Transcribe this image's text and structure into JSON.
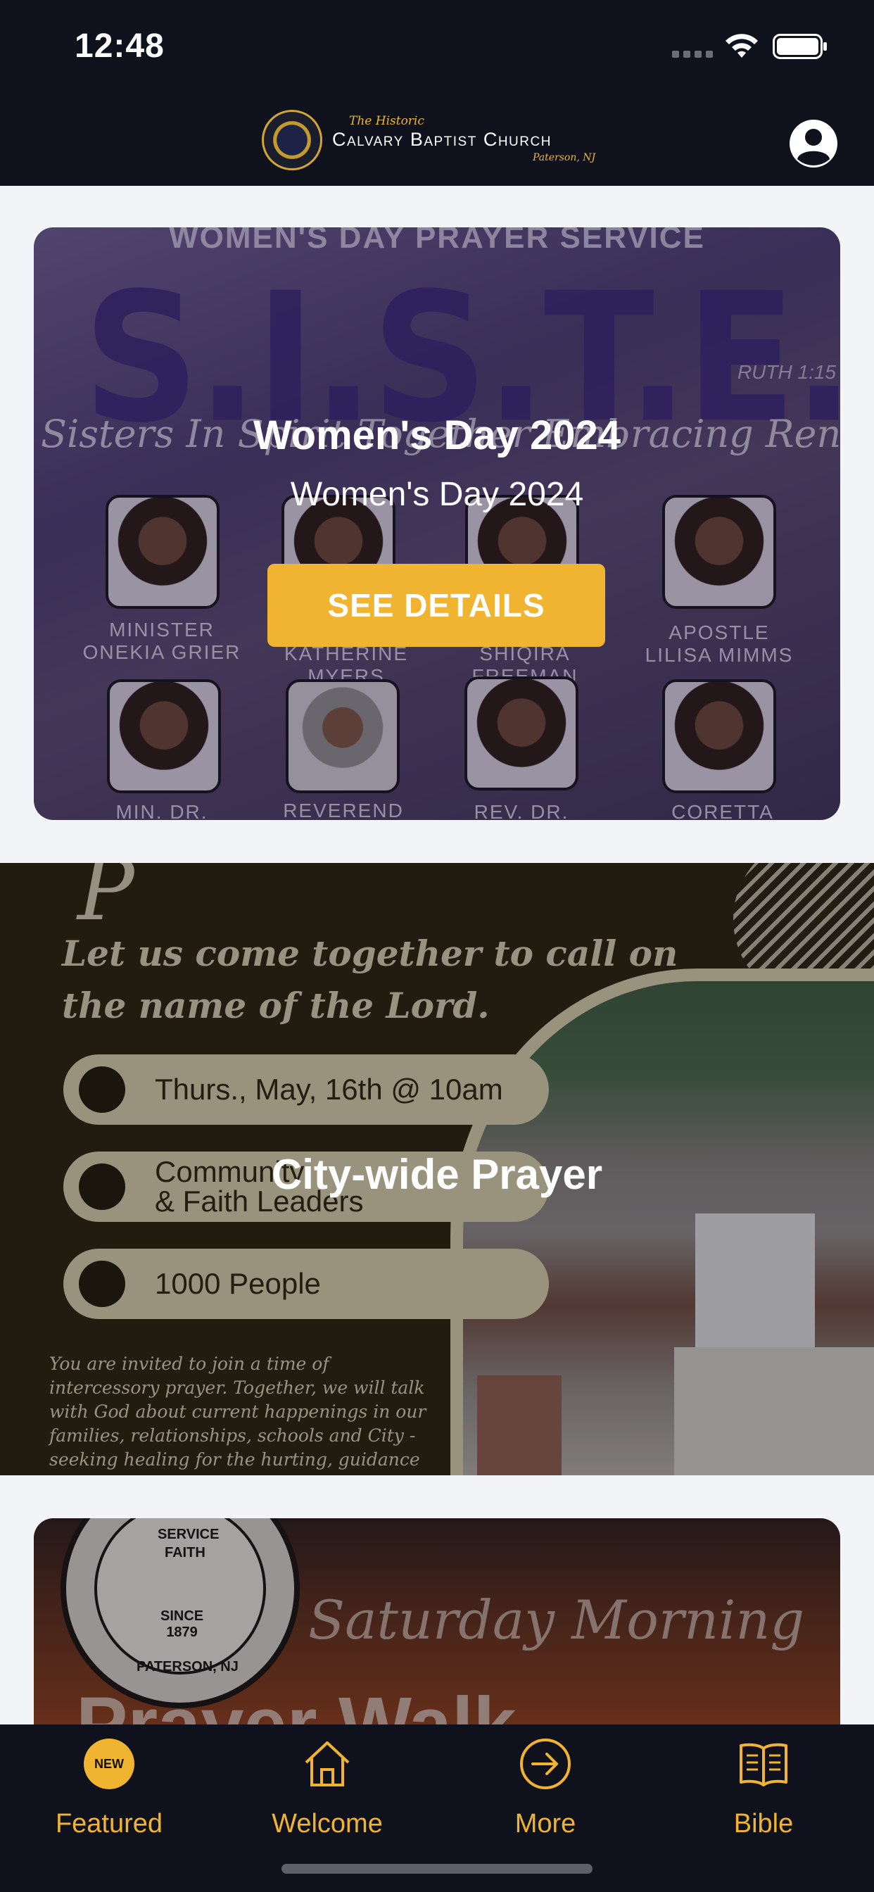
{
  "status_bar": {
    "time": "12:48"
  },
  "header": {
    "logo": {
      "tagline": "The Historic",
      "name": "Calvary Baptist Church",
      "location": "Paterson, NJ"
    },
    "profile_icon": "person-circle-icon"
  },
  "cards": [
    {
      "title": "Women's Day 2024",
      "subtitle": "Women's Day 2024",
      "button_label": "SEE DETAILS",
      "poster": {
        "heading": "WOMEN'S DAY PRAYER SERVICE",
        "big_text": "S.I.S.T.E.R.S.",
        "verse": "RUTH 1:15",
        "script": "Sisters In Spirit Together Embracing RenEWing Standing",
        "people": [
          {
            "name": "MINISTER\nONEKIA GRIER"
          },
          {
            "name": "KATHERINE MYERS"
          },
          {
            "name": "SHIQIRA FREEMAN"
          },
          {
            "name": "APOSTLE\nLILISA MIMMS"
          },
          {
            "name": "MIN. DR."
          },
          {
            "name": "REVEREND"
          },
          {
            "name": "REV. DR."
          },
          {
            "name": "CORETTA GOODWIN"
          }
        ]
      }
    },
    {
      "title": "City-wide Prayer",
      "flyer": {
        "lead": "Let us come together to call on the name of the Lord.",
        "items": [
          "Thurs., May, 16th @ 10am",
          "Community\n& Faith Leaders",
          "1000 People"
        ],
        "invite": "You are invited to join a time of intercessory prayer. Together, we will talk with God about current happenings in our families, relationships, schools and City - seeking healing for the hurting, guidance for our"
      }
    },
    {
      "poster": {
        "seal_top": "SERVICE",
        "seal_mid": "FAITH",
        "seal_since": "SINCE\n1879",
        "seal_place": "PATERSON, NJ",
        "script": "Saturday Morning",
        "big": "Prayer Walk"
      }
    }
  ],
  "tabbar": {
    "tabs": [
      {
        "label": "Featured",
        "icon": "new-badge-icon",
        "badge": "NEW"
      },
      {
        "label": "Welcome",
        "icon": "home-icon"
      },
      {
        "label": "More",
        "icon": "arrow-circle-icon"
      },
      {
        "label": "Bible",
        "icon": "book-icon"
      }
    ]
  },
  "colors": {
    "accent": "#f0b431",
    "bar": "#0f121c",
    "background": "#f3f4f8"
  }
}
